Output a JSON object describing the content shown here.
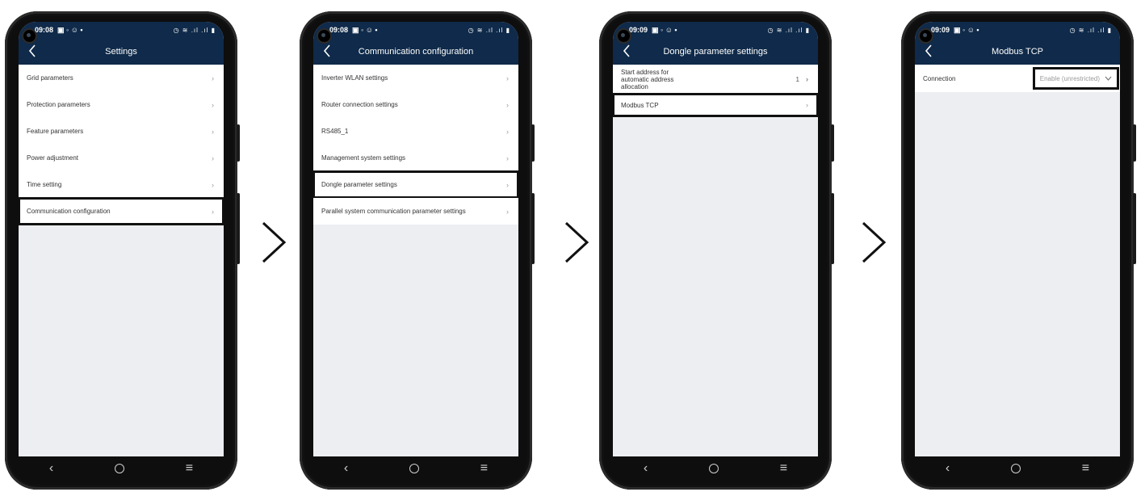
{
  "arrows": [
    "chevron-right-icon",
    "chevron-right-icon",
    "chevron-right-icon"
  ],
  "phones": [
    {
      "time": "09:08",
      "status_icons_left": "▣ ◦ ☺ •",
      "status_icons_right": "◷ ≋ .ıl .ıl ▮",
      "title": "Settings",
      "items": [
        {
          "label": "Grid parameters"
        },
        {
          "label": "Protection parameters"
        },
        {
          "label": "Feature parameters"
        },
        {
          "label": "Power adjustment"
        },
        {
          "label": "Time setting"
        },
        {
          "label": "Communication configuration",
          "highlighted": true
        }
      ]
    },
    {
      "time": "09:08",
      "status_icons_left": "▣ ◦ ☺ •",
      "status_icons_right": "◷ ≋ .ıl .ıl ▮",
      "title": "Communication configuration",
      "items": [
        {
          "label": "Inverter WLAN settings"
        },
        {
          "label": "Router connection settings"
        },
        {
          "label": "RS485_1"
        },
        {
          "label": "Management system settings"
        },
        {
          "label": "Dongle parameter settings",
          "highlighted": true
        },
        {
          "label": "Parallel system communication parameter settings"
        }
      ]
    },
    {
      "time": "09:09",
      "status_icons_left": "▣ ◦ ☺ •",
      "status_icons_right": "◷ ≋ .ıl .ıl ▮",
      "title": "Dongle parameter settings",
      "items": [
        {
          "label": "Start address for automatic address allocation",
          "value": "1"
        },
        {
          "label": "Modbus TCP",
          "highlighted": true
        }
      ]
    },
    {
      "time": "09:09",
      "status_icons_left": "▣ ◦ ☺ •",
      "status_icons_right": "◷ ≋ .ıl .ıl ▮",
      "title": "Modbus TCP",
      "connection": {
        "label": "Connection",
        "value": "Enable (unrestricted)",
        "highlighted": true
      }
    }
  ],
  "navbar": {
    "back": "‹",
    "menu": "≡"
  }
}
